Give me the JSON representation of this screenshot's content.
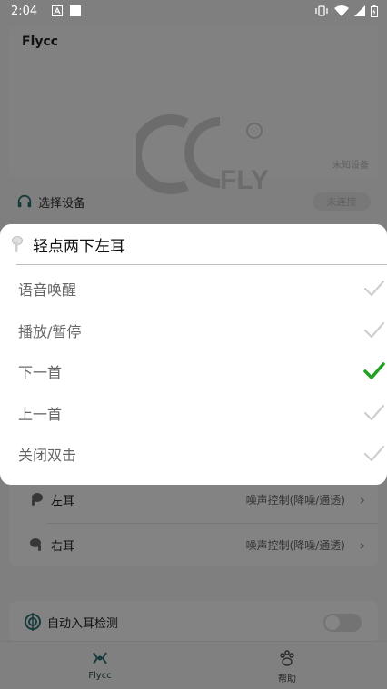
{
  "status_bar": {
    "time": "2:04",
    "icons": [
      "a-notification-icon",
      "square-notification-icon",
      "vibrate-icon",
      "wifi-icon",
      "signal-icon",
      "battery-icon"
    ]
  },
  "device_card": {
    "title": "Flycc",
    "status": "未知设备"
  },
  "select_device": {
    "label": "选择设备",
    "connect_label": "未连接"
  },
  "sheet": {
    "title": "轻点两下左耳",
    "options": [
      {
        "label": "语音唤醒",
        "selected": false
      },
      {
        "label": "播放/暂停",
        "selected": false
      },
      {
        "label": "下一首",
        "selected": true
      },
      {
        "label": "上一首",
        "selected": false
      },
      {
        "label": "关闭双击",
        "selected": false
      }
    ]
  },
  "ear_settings": {
    "left": {
      "name": "左耳",
      "value": "噪声控制(降噪/通透)"
    },
    "right": {
      "name": "右耳",
      "value": "噪声控制(降噪/通透)"
    }
  },
  "auto_detect": {
    "label": "自动入耳检测",
    "enabled": false
  },
  "bottom_nav": {
    "items": [
      {
        "label": "Flycc",
        "active": true
      },
      {
        "label": "帮助",
        "active": false
      }
    ]
  },
  "colors": {
    "accent": "#2c6f73",
    "check_selected": "#21a021",
    "check_unselected": "#cfcfcf",
    "overlay": "#000000"
  }
}
